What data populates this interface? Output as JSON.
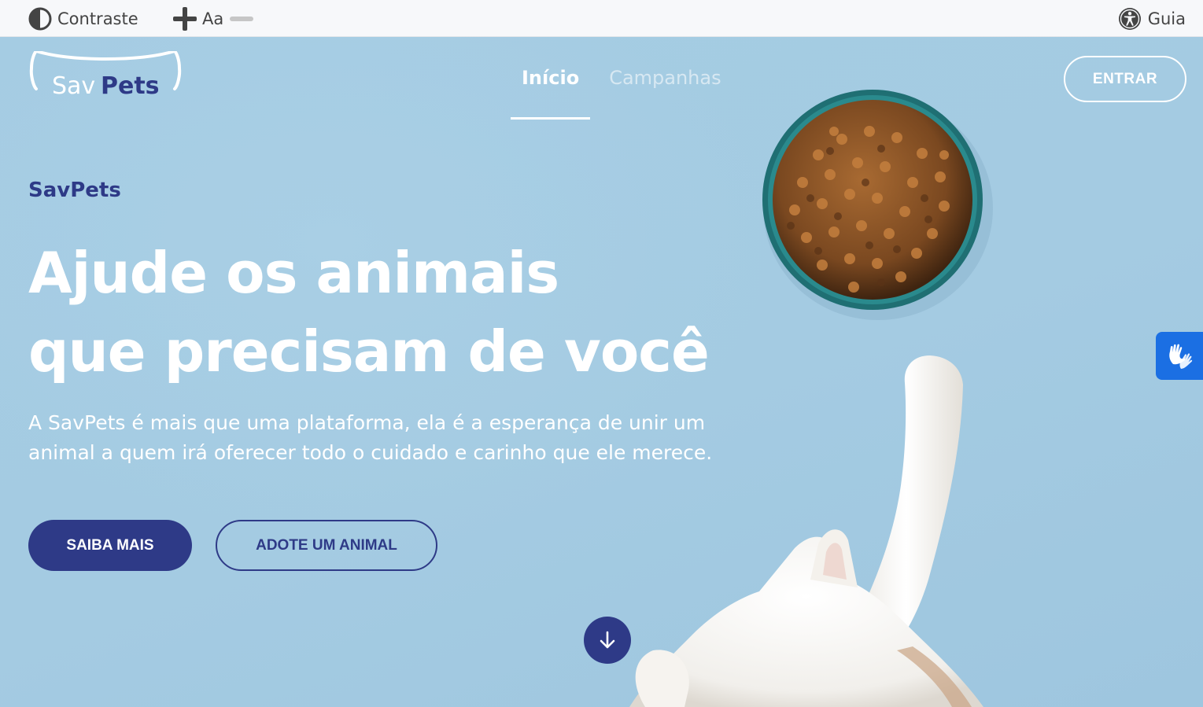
{
  "a11y_bar": {
    "contrast_label": "Contraste",
    "font_label": "Aa",
    "guide_label": "Guia",
    "icons": [
      "contrast-icon",
      "plus-icon",
      "minus-icon",
      "accessibility-icon"
    ]
  },
  "brand": {
    "name_light": "Sav",
    "name_bold": "Pets"
  },
  "nav": {
    "items": [
      {
        "label": "Início",
        "active": true
      },
      {
        "label": "Campanhas",
        "active": false
      }
    ],
    "login_label": "ENTRAR"
  },
  "hero": {
    "eyebrow": "SavPets",
    "headline_line1": "Ajude os animais",
    "headline_line2": "que precisam de você",
    "lead": "A SavPets é mais que uma plataforma, ela é a esperança de unir um animal a quem irá oferecer todo o cuidado e carinho que ele merece.",
    "primary_button": "SAIBA MAIS",
    "secondary_button": "ADOTE UM ANIMAL"
  },
  "floating": {
    "libras_icon": "sign-language-hands-icon",
    "scroll_icon": "arrow-down-icon"
  },
  "colors": {
    "brand_navy": "#2e3a87",
    "hero_blue": "#a5cce3",
    "bowl_teal": "#1f6f73",
    "libras_blue": "#1b6fe3",
    "topbar_bg": "#f7f8fa"
  }
}
